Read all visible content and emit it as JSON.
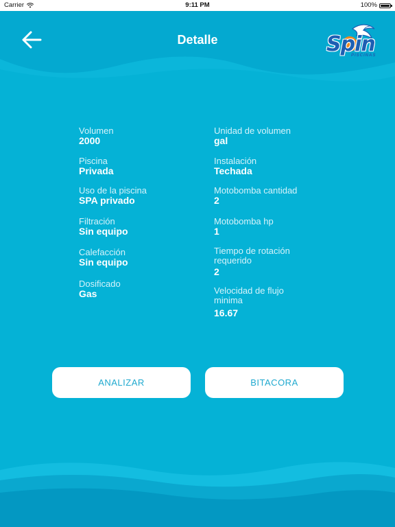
{
  "status_bar": {
    "carrier": "Carrier",
    "time": "9:11 PM",
    "battery": "100%"
  },
  "header": {
    "title": "Detalle",
    "logo_text": "Spin",
    "logo_subtext": "PISCINAS"
  },
  "details": {
    "left": [
      {
        "label": "Volumen",
        "value": "2000"
      },
      {
        "label": "Piscina",
        "value": "Privada"
      },
      {
        "label": "Uso de la piscina",
        "value": "SPA privado"
      },
      {
        "label": "Filtración",
        "value": "Sin equipo"
      },
      {
        "label": "Calefacción",
        "value": "Sin equipo"
      },
      {
        "label": "Dosificado",
        "value": "Gas"
      }
    ],
    "right": [
      {
        "label": "Unidad de volumen",
        "value": "gal"
      },
      {
        "label": "Instalación",
        "value": "Techada"
      },
      {
        "label": "Motobomba cantidad",
        "value": "2"
      },
      {
        "label": "Motobomba hp",
        "value": "1"
      },
      {
        "label": "Tiempo de rotación requerido",
        "value": "2"
      },
      {
        "label": "Velocidad de flujo minima",
        "value": "16.67"
      }
    ]
  },
  "actions": {
    "analyze_label": "ANALIZAR",
    "log_label": "BITACORA"
  },
  "colors": {
    "background": "#05b2d6",
    "wave_dark": "#039fc4",
    "wave_light": "#18c0e2",
    "button_text": "#1fa9cf",
    "logo_blue": "#1d5fb3"
  }
}
